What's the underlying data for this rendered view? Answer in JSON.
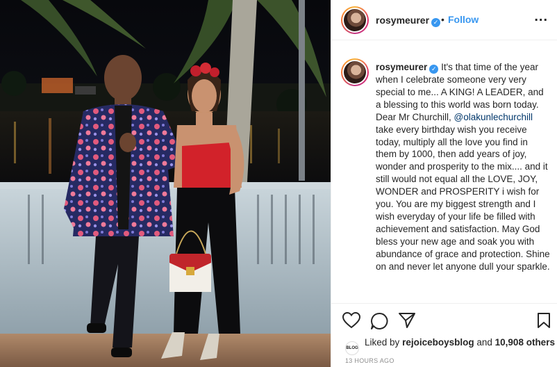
{
  "post": {
    "username": "rosymeurer",
    "follow_label": "Follow",
    "separator": "•",
    "more_label": "...",
    "caption": {
      "username": "rosymeurer",
      "text_before_mention": "It's that time of the year when I celebrate someone very very special to me... A KING! A LEADER, and a blessing to this world was born today.",
      "line2_prefix": "Dear Mr Churchill,",
      "mention": "@olakunlechurchill",
      "text_after_mention": "take every birthday wish you receive today, multiply all the love you find in them by 1000, then add years of joy, wonder and prosperity to the mix.... and it still would not equal all the LOVE, JOY, WONDER and PROSPERITY i wish for you. You are my biggest strength and I wish everyday of your life be filled with achievement and satisfaction. May God bless your new age and soak you with abundance of grace and protection. Shine on and never let anyone dull your sparkle."
    },
    "likes": {
      "prefix": "Liked by",
      "liker": "rejoiceboysblog",
      "conjunction": "and",
      "others": "10,908 others",
      "liker_avatar_text": "BLOG"
    },
    "timestamp": "13 HOURS AGO"
  },
  "icons": {
    "like": "heart-icon",
    "comment": "comment-icon",
    "share": "share-icon",
    "save": "bookmark-icon",
    "verified": "verified-badge-icon"
  },
  "colors": {
    "link_blue": "#3897f0",
    "mention": "#00376b",
    "timestamp": "#8e8e8e"
  }
}
